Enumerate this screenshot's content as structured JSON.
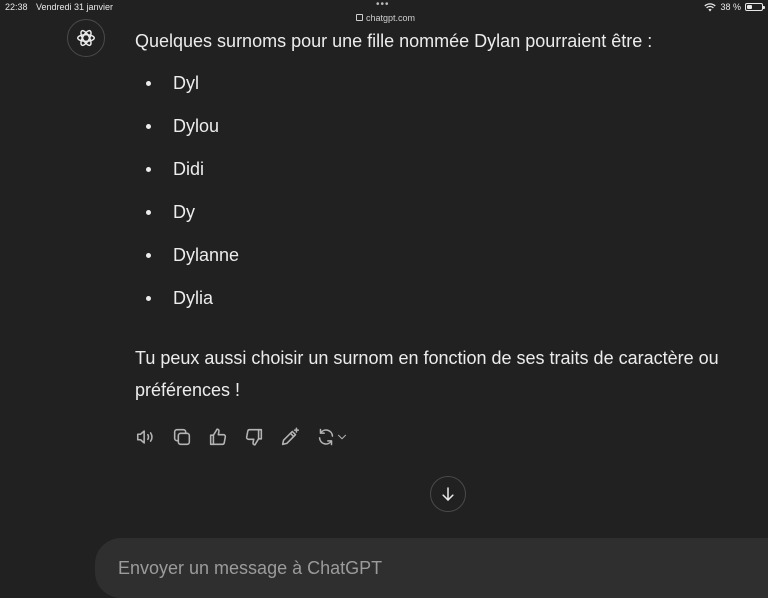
{
  "status_bar": {
    "time": "22:38",
    "date": "Vendredi 31 janvier",
    "url": "chatgpt.com",
    "battery": "38 %",
    "battery_level": 0.38
  },
  "message": {
    "intro": "Quelques surnoms pour une fille nommée Dylan pourraient être :",
    "nicknames": [
      "Dyl",
      "Dylou",
      "Didi",
      "Dy",
      "Dylanne",
      "Dylia"
    ],
    "outro_line1": "Tu peux aussi choisir un surnom en fonction de ses traits de caractère ou",
    "outro_line2": "préférences !"
  },
  "actions": [
    "speaker-icon",
    "copy-icon",
    "thumbs-up-icon",
    "thumbs-down-icon",
    "edit-sparkle-icon",
    "regenerate-icon"
  ],
  "composer": {
    "placeholder": "Envoyer un message à ChatGPT",
    "value": ""
  },
  "colors": {
    "background": "#212121",
    "composer": "#2f2f2f",
    "text": "#ececec",
    "icon": "#b4b4b4"
  }
}
